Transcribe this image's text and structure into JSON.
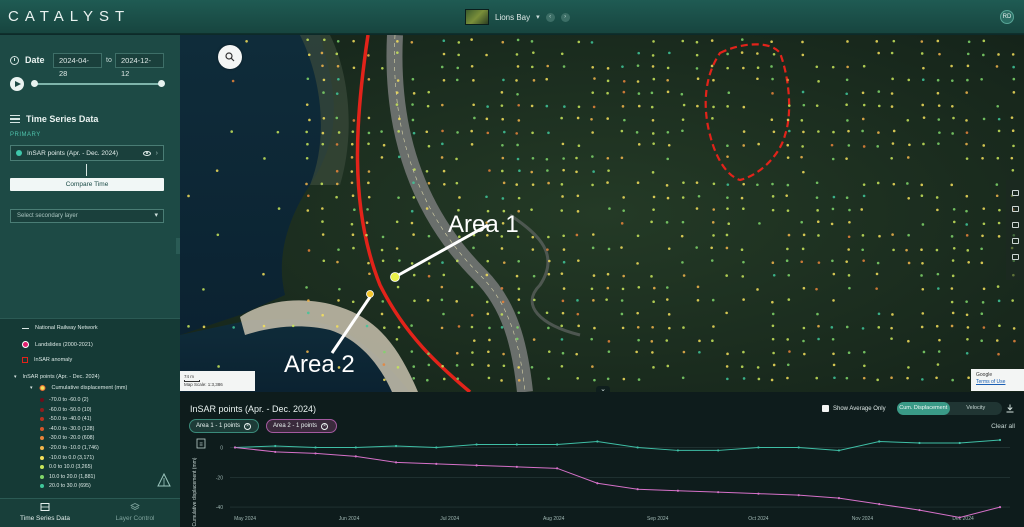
{
  "header": {
    "logo": "CATALYST",
    "site_name": "Lions Bay",
    "avatar_initials": "RD"
  },
  "sidebar": {
    "date_label": "Date",
    "date_from": "2024-04-28",
    "date_to_label": "to",
    "date_to": "2024-12-12",
    "time_series_title": "Time Series Data",
    "primary_label": "PRIMARY",
    "primary_layer": "InSAR points (Apr. - Dec. 2024)",
    "compare_button": "Compare Time",
    "secondary_placeholder": "Select secondary layer",
    "legend": {
      "railway": "National Railway Network",
      "landslides": "Landslides (2000-2021)",
      "anomaly": "InSAR anomaly",
      "insar_group": "InSAR points (Apr. - Dec. 2024)",
      "cumulative": "Cumulative displacement (mm)",
      "bins": [
        {
          "label": "-70.0 to -60.0 (2)",
          "color": "#6b0f1a"
        },
        {
          "label": "-60.0 to -50.0 (10)",
          "color": "#8f1d1d"
        },
        {
          "label": "-50.0 to -40.0 (41)",
          "color": "#b8321f"
        },
        {
          "label": "-40.0 to -30.0 (128)",
          "color": "#d7562a"
        },
        {
          "label": "-30.0 to -20.0 (608)",
          "color": "#e9853a"
        },
        {
          "label": "-20.0 to -10.0 (1,746)",
          "color": "#f2b64b"
        },
        {
          "label": "-10.0 to 0.0 (3,171)",
          "color": "#f4e05a"
        },
        {
          "label": "0.0 to 10.0 (3,265)",
          "color": "#c8e65a"
        },
        {
          "label": "10.0 to 20.0 (1,881)",
          "color": "#7fd66a"
        },
        {
          "label": "20.0 to 30.0 (695)",
          "color": "#3fc79a"
        }
      ]
    },
    "tabs": {
      "time_series": "Time Series Data",
      "layer_control": "Layer Control"
    }
  },
  "map": {
    "area1_label": "Area 1",
    "area2_label": "Area 2",
    "scale_text": "74 m",
    "map_scale": "Map Scale: 1:3,386",
    "attrib_google": "Google",
    "attrib_terms": "Terms of Use"
  },
  "panel": {
    "title": "InSAR points (Apr. - Dec. 2024)",
    "show_average": "Show Average Only",
    "toggle_cum": "Cum. Displacement",
    "toggle_vel": "Velocity",
    "chip1": "Area 1 - 1 points",
    "chip2": "Area 2 - 1 points",
    "clear_all": "Clear all",
    "ylabel": "Cumulative displacement (mm)",
    "y_ticks": [
      "0",
      "-20",
      "-40"
    ]
  },
  "colors": {
    "series1": "#3fbfa6",
    "series2": "#d671c9",
    "railway": "#e2231a",
    "anomaly": "#e2231a"
  },
  "chart_data": {
    "type": "line",
    "title": "InSAR points (Apr. - Dec. 2024)",
    "xlabel": "",
    "ylabel": "Cumulative displacement (mm)",
    "x_ticks": [
      "May 2024",
      "Jun 2024",
      "Jul 2024",
      "Aug 2024",
      "Sep 2024",
      "Oct 2024",
      "Nov 2024",
      "Dec 2024"
    ],
    "ylim": [
      -50,
      5
    ],
    "x_dates": [
      "2024-04-28",
      "2024-05-10",
      "2024-05-22",
      "2024-06-03",
      "2024-06-15",
      "2024-06-27",
      "2024-07-09",
      "2024-07-21",
      "2024-08-02",
      "2024-08-14",
      "2024-08-26",
      "2024-09-07",
      "2024-09-19",
      "2024-10-01",
      "2024-10-13",
      "2024-10-25",
      "2024-11-06",
      "2024-11-18",
      "2024-11-30",
      "2024-12-12"
    ],
    "series": [
      {
        "name": "Area 1 - 1 points",
        "values": [
          0,
          1,
          0,
          0,
          1,
          0,
          2,
          2,
          2,
          4,
          0,
          -2,
          -2,
          0,
          0,
          -2,
          4,
          3,
          3,
          5
        ]
      },
      {
        "name": "Area 2 - 1 points",
        "values": [
          0,
          -3,
          -4,
          -6,
          -10,
          -11,
          -12,
          -13,
          -14,
          -24,
          -28,
          -29,
          -30,
          -31,
          -32,
          -34,
          -38,
          -42,
          -47,
          -40
        ]
      }
    ],
    "grid": true
  }
}
